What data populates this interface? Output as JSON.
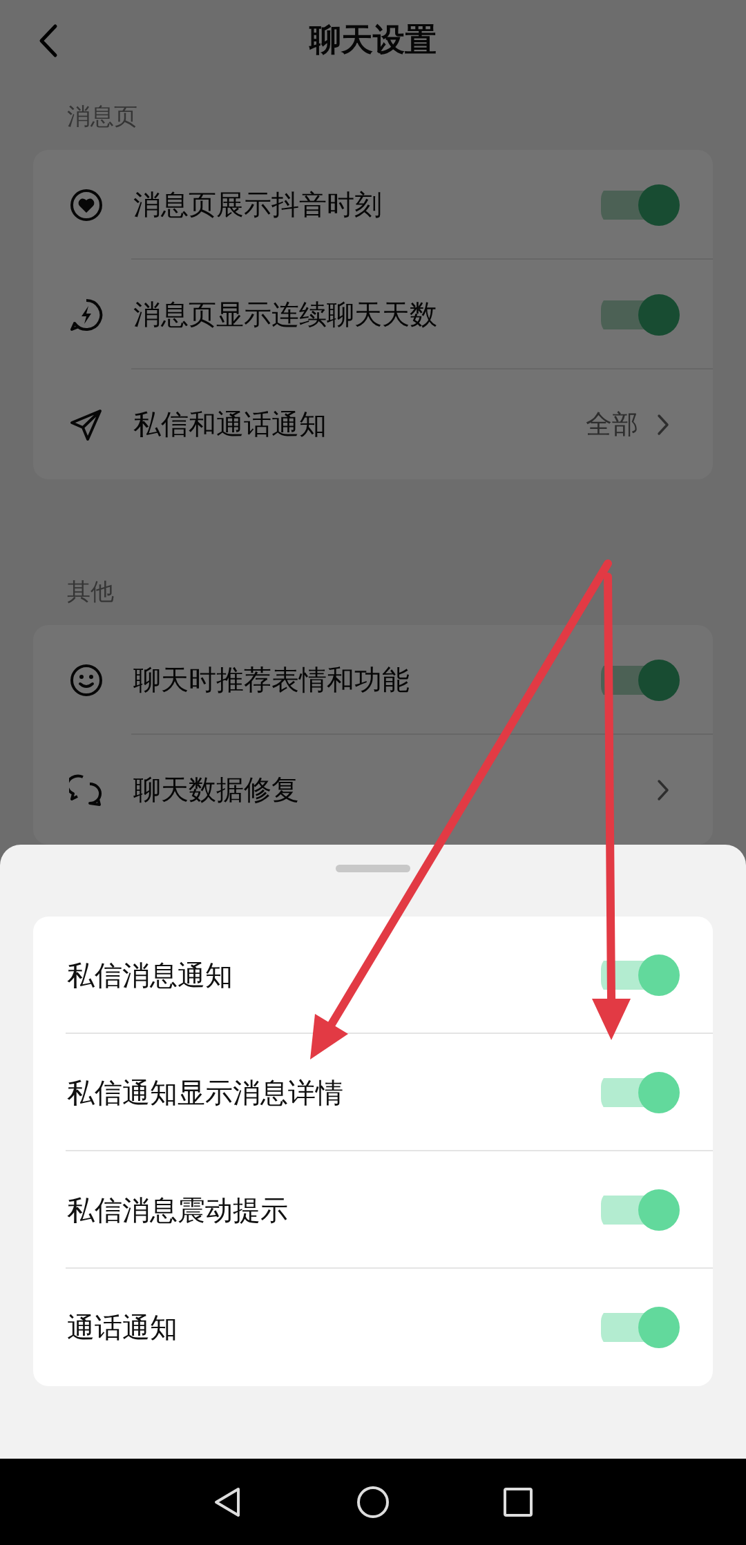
{
  "header": {
    "title": "聊天设置"
  },
  "sections": [
    {
      "label": "消息页",
      "items": [
        {
          "kind": "toggle",
          "label": "消息页展示抖音时刻",
          "on": true
        },
        {
          "kind": "toggle",
          "label": "消息页显示连续聊天天数",
          "on": true
        },
        {
          "kind": "link",
          "label": "私信和通话通知",
          "value": "全部"
        }
      ]
    },
    {
      "label": "其他",
      "items": [
        {
          "kind": "toggle",
          "label": "聊天时推荐表情和功能",
          "on": true
        },
        {
          "kind": "link",
          "label": "聊天数据修复"
        }
      ]
    }
  ],
  "sheet": {
    "items": [
      {
        "label": "私信消息通知",
        "on": true
      },
      {
        "label": "私信通知显示消息详情",
        "on": true
      },
      {
        "label": "私信消息震动提示",
        "on": true
      },
      {
        "label": "通话通知",
        "on": true
      }
    ]
  }
}
